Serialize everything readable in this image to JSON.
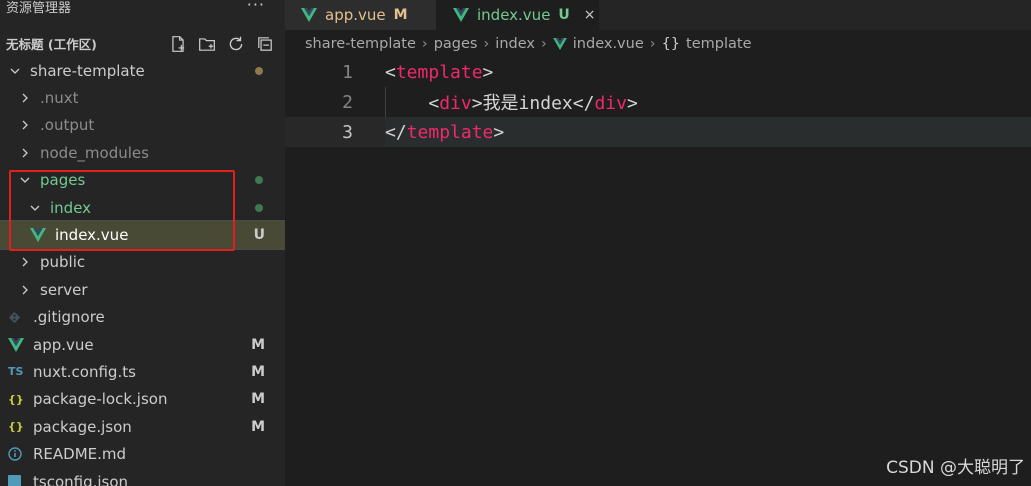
{
  "sidebar": {
    "panel_title": "资源管理器",
    "more_icon": "ellipsis-icon",
    "workspace_title": "无标题 (工作区)",
    "actions": [
      {
        "name": "new-file-icon"
      },
      {
        "name": "new-folder-icon"
      },
      {
        "name": "refresh-icon"
      },
      {
        "name": "collapse-all-icon"
      }
    ],
    "tree": [
      {
        "label": "share-template",
        "type": "folder-open",
        "depth": 0,
        "color": "#cccccc",
        "status_dot": "#8d7a4d"
      },
      {
        "label": ".nuxt",
        "type": "folder",
        "depth": 1,
        "color": "#8c8c8c"
      },
      {
        "label": ".output",
        "type": "folder",
        "depth": 1,
        "color": "#8c8c8c"
      },
      {
        "label": "node_modules",
        "type": "folder",
        "depth": 1,
        "color": "#8c8c8c"
      },
      {
        "label": "pages",
        "type": "folder-open",
        "depth": 1,
        "color": "#73c991",
        "status_dot": "#3e7a4d"
      },
      {
        "label": "index",
        "type": "folder-open",
        "depth": 2,
        "color": "#73c991",
        "status_dot": "#3e7a4d"
      },
      {
        "label": "index.vue",
        "type": "vue",
        "depth": 2,
        "color": "#ffffff",
        "status": "U",
        "selected": true
      },
      {
        "label": "public",
        "type": "folder",
        "depth": 1,
        "color": "#cccccc"
      },
      {
        "label": "server",
        "type": "folder",
        "depth": 1,
        "color": "#cccccc"
      },
      {
        "label": ".gitignore",
        "type": "git",
        "depth": 1,
        "color": "#cccccc"
      },
      {
        "label": "app.vue",
        "type": "vue",
        "depth": 1,
        "color": "#cccccc",
        "status": "M"
      },
      {
        "label": "nuxt.config.ts",
        "type": "ts",
        "depth": 1,
        "color": "#cccccc",
        "status": "M"
      },
      {
        "label": "package-lock.json",
        "type": "json",
        "depth": 1,
        "color": "#cccccc",
        "status": "M"
      },
      {
        "label": "package.json",
        "type": "json",
        "depth": 1,
        "color": "#cccccc",
        "status": "M"
      },
      {
        "label": "README.md",
        "type": "info",
        "depth": 1,
        "color": "#cccccc"
      },
      {
        "label": "tsconfig.json",
        "type": "ts-json",
        "depth": 1,
        "color": "#cccccc"
      }
    ]
  },
  "tabs": [
    {
      "label": "app.vue",
      "mark": "M",
      "mark_color": "#e2c08d",
      "label_color": "#e2c08d",
      "active": false
    },
    {
      "label": "index.vue",
      "mark": "U",
      "mark_color": "#73c991",
      "label_color": "#73c991",
      "active": true,
      "close": "×"
    }
  ],
  "breadcrumb": {
    "items": [
      "share-template",
      "pages",
      "index",
      "index.vue",
      "template"
    ],
    "separator": "›",
    "brace": "{}"
  },
  "editor": {
    "lines": [
      {
        "num": "1",
        "tokens": [
          {
            "t": "<",
            "c": "b"
          },
          {
            "t": "template",
            "c": "tag"
          },
          {
            "t": ">",
            "c": "b"
          }
        ]
      },
      {
        "num": "2",
        "tokens": [
          {
            "t": "    ",
            "c": "txt"
          },
          {
            "t": "<",
            "c": "b"
          },
          {
            "t": "div",
            "c": "tag"
          },
          {
            "t": ">",
            "c": "b"
          },
          {
            "t": "我是index",
            "c": "txt"
          },
          {
            "t": "</",
            "c": "b"
          },
          {
            "t": "div",
            "c": "tag"
          },
          {
            "t": ">",
            "c": "b"
          }
        ]
      },
      {
        "num": "3",
        "tokens": [
          {
            "t": "</",
            "c": "b"
          },
          {
            "t": "template",
            "c": "tag"
          },
          {
            "t": ">",
            "c": "b"
          }
        ],
        "current": true
      }
    ]
  },
  "watermark": "CSDN @大聪明了",
  "colors": {
    "vue_green": "#41b883",
    "vue_dark": "#35495e",
    "modified": "#e2c08d",
    "untracked": "#73c991",
    "highlight_box": "#e0201b"
  }
}
